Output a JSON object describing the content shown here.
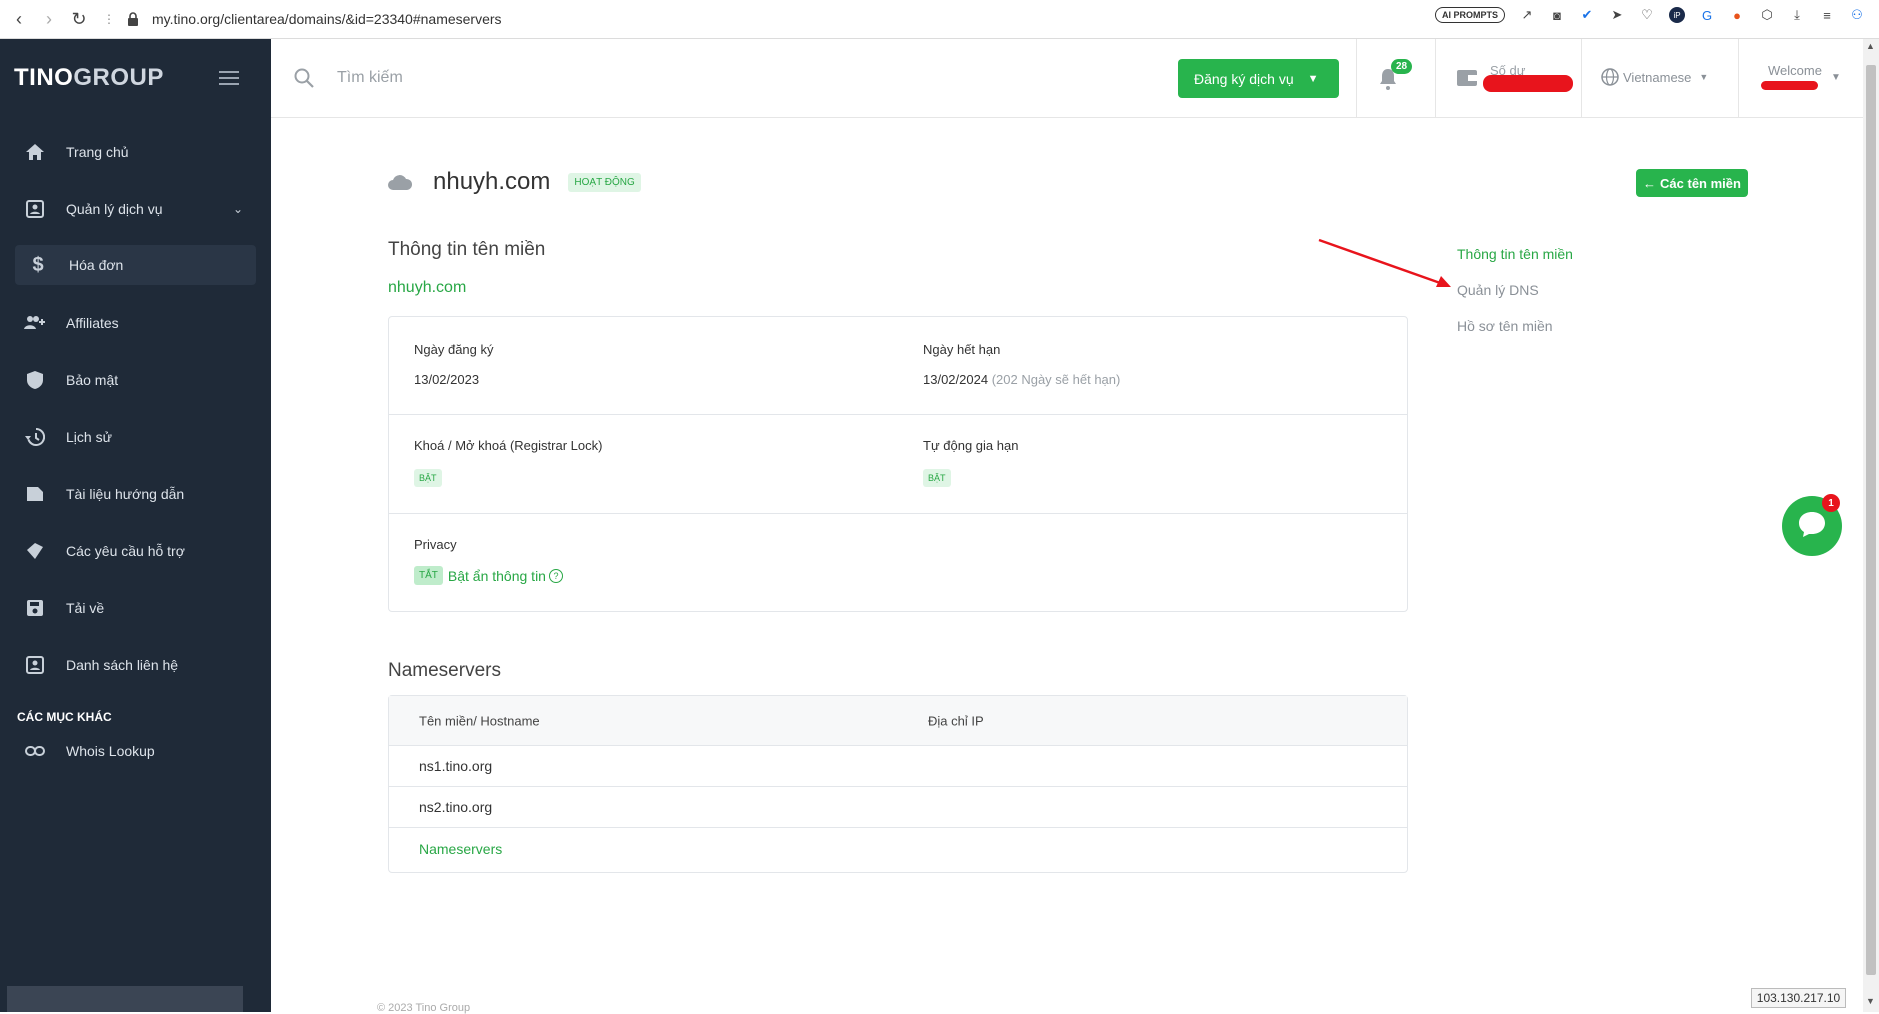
{
  "browser": {
    "url": "my.tino.org/clientarea/domains/&id=23340#nameservers",
    "ai_prompts_label": "AI PROMPTS"
  },
  "sidebar": {
    "logo_bold": "TINO",
    "logo_light": "GROUP",
    "items": [
      {
        "label": "Trang chủ",
        "icon": "home-icon"
      },
      {
        "label": "Quản lý dịch vụ",
        "icon": "account-box-icon"
      },
      {
        "label": "Hóa đơn",
        "icon": "dollar-icon"
      },
      {
        "label": "Affiliates",
        "icon": "user-plus-icon"
      },
      {
        "label": "Bảo mật",
        "icon": "shield-icon"
      },
      {
        "label": "Lịch sử",
        "icon": "history-icon"
      },
      {
        "label": "Tài liệu hướng dẫn",
        "icon": "document-icon"
      },
      {
        "label": "Các yêu cầu hỗ trợ",
        "icon": "ticket-icon"
      },
      {
        "label": "Tải về",
        "icon": "save-icon"
      },
      {
        "label": "Danh sách liên hệ",
        "icon": "contact-icon"
      }
    ],
    "other_section": "CÁC MỤC KHÁC",
    "other_items": [
      {
        "label": "Whois Lookup",
        "icon": "link-icon"
      }
    ]
  },
  "header": {
    "search_placeholder": "Tìm kiếm",
    "register_label": "Đăng ký dịch vụ",
    "notification_count": "28",
    "balance_label": "Số dư",
    "language": "Vietnamese",
    "welcome": "Welcome"
  },
  "domain": {
    "name": "nhuyh.com",
    "status": "HOẠT ĐỘNG",
    "back_button": "Các tên miền",
    "info_title": "Thông tin tên miền",
    "info_link": "nhuyh.com",
    "reg_date_label": "Ngày đăng ký",
    "reg_date": "13/02/2023",
    "exp_date_label": "Ngày hết hạn",
    "exp_date": "13/02/2024",
    "exp_note": "(202 Ngày sẽ hết hạn)",
    "lock_label": "Khoá / Mở khoá (Registrar Lock)",
    "lock_status": "BẬT",
    "autorenew_label": "Tự động gia hạn",
    "autorenew_status": "BẬT",
    "privacy_label": "Privacy",
    "privacy_status": "TẮT",
    "privacy_action": "Bật ẩn thông tin",
    "help": "?"
  },
  "nameservers": {
    "title": "Nameservers",
    "col_host": "Tên miền/ Hostname",
    "col_ip": "Địa chỉ IP",
    "rows": [
      {
        "host": "ns1.tino.org",
        "ip": ""
      },
      {
        "host": "ns2.tino.org",
        "ip": ""
      }
    ],
    "footer_link": "Nameservers"
  },
  "right_nav": {
    "items": [
      "Thông tin tên miền",
      "Quản lý DNS",
      "Hồ sơ tên miền"
    ]
  },
  "chat": {
    "badge": "1"
  },
  "ip_address": "103.130.217.10",
  "footer": {
    "copyright": "© 2023 Tino Group"
  },
  "colors": {
    "brand_green": "#28b44d",
    "sidebar_bg": "#1f2a38",
    "annotation_red": "#e8141c"
  }
}
